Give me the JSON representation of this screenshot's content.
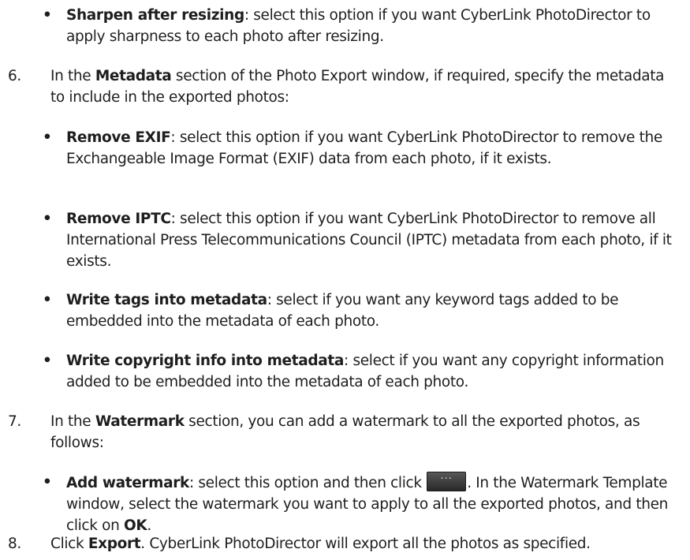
{
  "items": {
    "sharpen": {
      "term": "Sharpen after resizing",
      "desc": ": select this option if you want CyberLink PhotoDirector to apply sharpness to each photo after resizing."
    },
    "step6": {
      "number": "6.",
      "pre": "In the ",
      "term": "Metadata",
      "post": " section of the Photo Export window, if required, specify the metadata to include in the exported photos:"
    },
    "remove_exif": {
      "term": "Remove EXIF",
      "desc": ": select this option if you want CyberLink PhotoDirector to remove the Exchangeable Image Format (EXIF) data from each photo, if it exists."
    },
    "remove_iptc": {
      "term": "Remove IPTC",
      "desc": ": select this option if you want CyberLink PhotoDirector to remove all International Press Telecommunications Council (IPTC) metadata from each photo, if it exists."
    },
    "write_tags": {
      "term": "Write tags into metadata",
      "desc": ": select if you want any keyword tags added to be embedded into the metadata of each photo."
    },
    "write_copyright": {
      "term": "Write copyright info into metadata",
      "desc": ": select if you want any copyright information added to be embedded into the metadata of each photo."
    },
    "step7": {
      "number": "7.",
      "pre": "In the ",
      "term": "Watermark",
      "post": " section, you can add a watermark to all the exported photos, as follows:"
    },
    "add_watermark": {
      "term": "Add watermark",
      "desc_a": ": select this option and then click ",
      "button_glyph": "···",
      "desc_b": ". In the Watermark Template window, select the watermark you want to apply to all the exported photos, and then click on ",
      "ok": "OK",
      "desc_c": "."
    },
    "step8": {
      "number": "8.",
      "pre": "Click ",
      "term": "Export",
      "post": ". CyberLink PhotoDirector will export all the photos as specified."
    }
  },
  "bullet_glyph": "•"
}
